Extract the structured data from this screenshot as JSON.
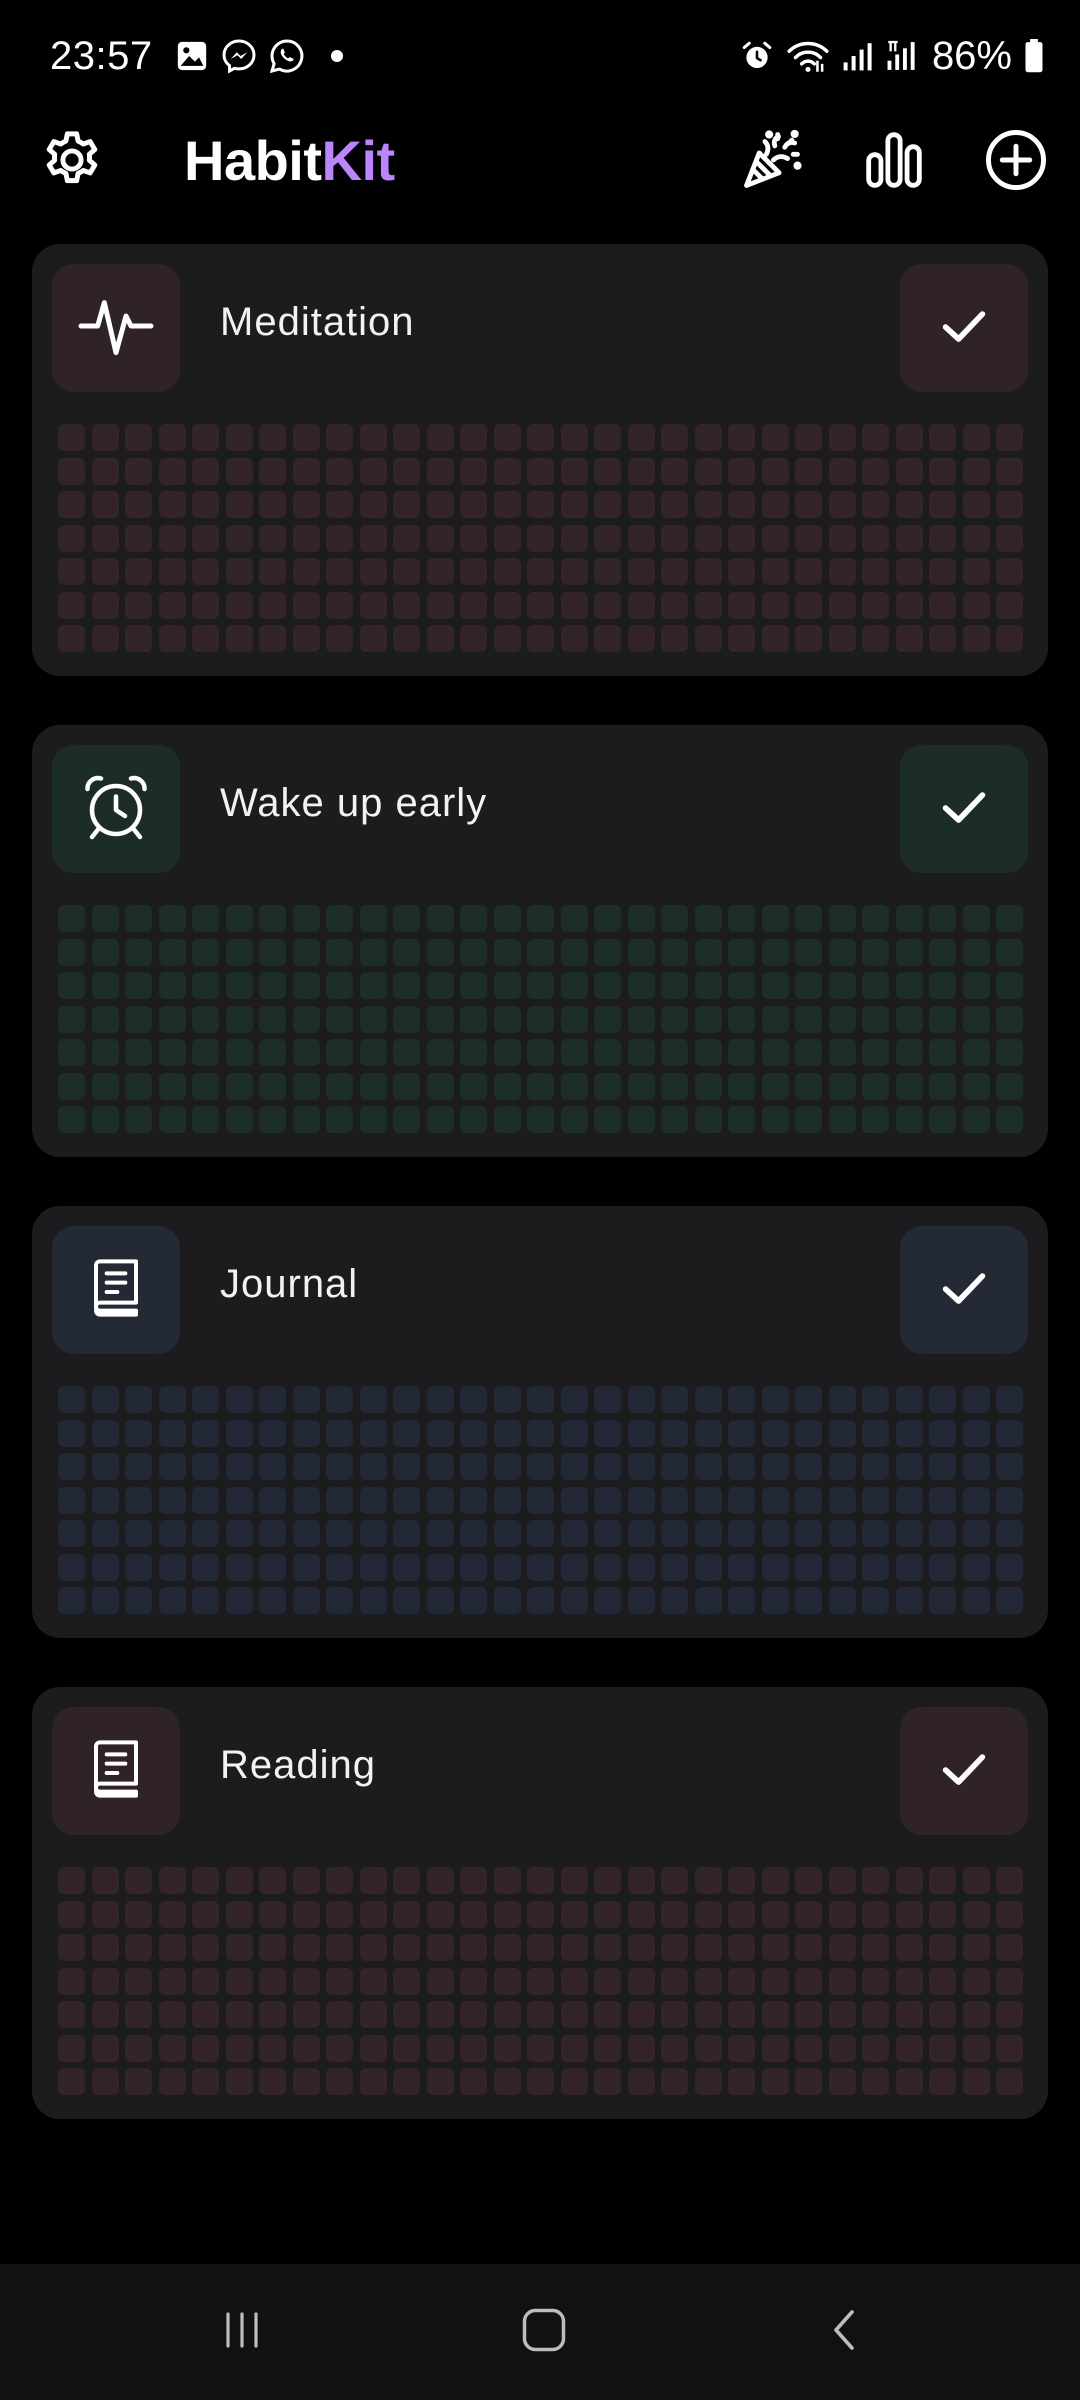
{
  "status_bar": {
    "time": "23:57",
    "battery": "86%",
    "icons_left": [
      "gallery-icon",
      "messenger-icon",
      "whatsapp-icon",
      "dot-icon"
    ],
    "icons_right": [
      "alarm-icon",
      "wifi-icon",
      "signal-icon",
      "signal-lte-icon",
      "battery-icon"
    ]
  },
  "app_bar": {
    "title_part1": "Habit",
    "title_part2": "Kit",
    "accent": "#bb86fc",
    "left_icon": "settings-gear-icon",
    "right_icons": [
      "celebration-party-icon",
      "statistics-bar-chart-icon",
      "add-circle-icon"
    ]
  },
  "habits": [
    {
      "name": "Meditation",
      "icon": "pulse-heartbeat-icon",
      "tint": "#2f2327",
      "cell": "#33242a",
      "done_today": false
    },
    {
      "name": "Wake up early",
      "icon": "alarm-clock-icon",
      "tint": "#1c2d29",
      "cell": "#1d2e2a",
      "done_today": false
    },
    {
      "name": "Journal",
      "icon": "book-icon",
      "tint": "#232935",
      "cell": "#222836",
      "done_today": false
    },
    {
      "name": "Reading",
      "icon": "book-icon",
      "tint": "#2f2327",
      "cell": "#33242a",
      "done_today": false
    }
  ],
  "grid": {
    "columns": 29,
    "rows": 7
  },
  "nav_bar": {
    "buttons": [
      "recent-apps-icon",
      "home-icon",
      "back-icon"
    ]
  }
}
